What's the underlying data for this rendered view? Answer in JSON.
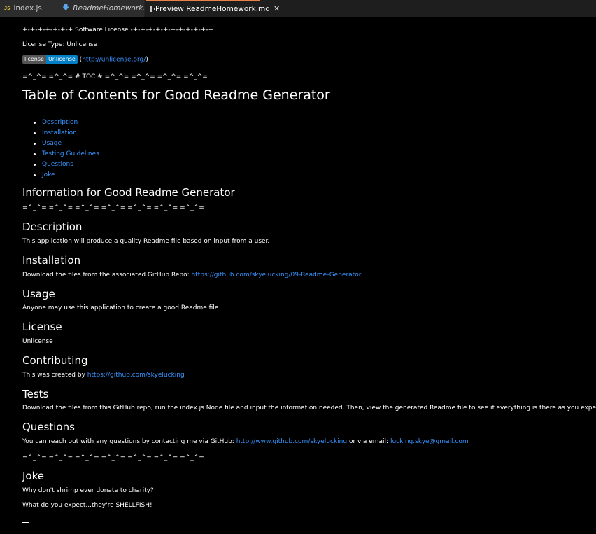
{
  "tabs": [
    {
      "label": "index.js",
      "icon": "javascript-file-icon",
      "icon_text": "JS"
    },
    {
      "label": "ReadmeHomework.md",
      "icon": "markdown-file-icon"
    },
    {
      "label": "Preview ReadmeHomework.md",
      "icon": "preview-icon",
      "close": "✕"
    }
  ],
  "colors": {
    "link": "#3794ff",
    "active_tab_border": "#e8824a",
    "badge_left": "#555555",
    "badge_right": "#007ec6"
  },
  "doc": {
    "license_banner": "+-+-+-+-+-+-+ Software License -+-+-+-+-+-+-+-+-+-+-+",
    "license_type": "License Type: Unlicense",
    "badge_left": "license",
    "badge_right": "Unlicense",
    "badge_link_open": "(",
    "badge_link": "http://unlicense.org/",
    "badge_link_close": ")",
    "toc_marker": "=^_^= =^_^= # TOC # =^_^= =^_^= =^_^= =^_^=",
    "toc_title": "Table of Contents for Good Readme Generator",
    "toc_items": [
      "Description",
      "Installation",
      "Usage",
      "Testing Guidelines",
      "Questions",
      "Joke"
    ],
    "info_title": "Information for Good Readme Generator",
    "cat_line": "=^_^= =^_^= =^_^= =^_^= =^_^= =^_^= =^_^=",
    "description_heading": "Description",
    "description_text": "This application will produce a quality Readme file based on input from a user.",
    "installation_heading": "Installation",
    "installation_text": "Download the files from the associated GitHub Repo:",
    "installation_link": "https://github.com/skyelucking/09-Readme-Generator",
    "usage_heading": "Usage",
    "usage_text": "Anyone may use this application to create a good Readme file",
    "license_heading": "License",
    "license_text": "Unlicense",
    "contributing_heading": "Contributing",
    "contributing_text": "This was created by",
    "contributing_link": "https://github.com/skyelucking",
    "tests_heading": "Tests",
    "tests_text": "Download the files from this GitHub repo, run the index.js Node file and input the information needed. Then, view the generated Readme file to see if everything is there as you expected.",
    "questions_heading": "Questions",
    "questions_text_1": "You can reach out with any questions by contacting me via GitHub:",
    "questions_github_link": "http://www.github.com/skyelucking",
    "questions_text_2": "or via email:",
    "questions_email_link": "lucking.skye@gmail.com",
    "cat_line_2": "=^_^= =^_^= =^_^= =^_^= =^_^= =^_^= =^_^=",
    "joke_heading": "Joke",
    "joke_question": "Why don't shrimp ever donate to charity?",
    "joke_answer": "What do you expect...they're SHELLFISH!"
  }
}
